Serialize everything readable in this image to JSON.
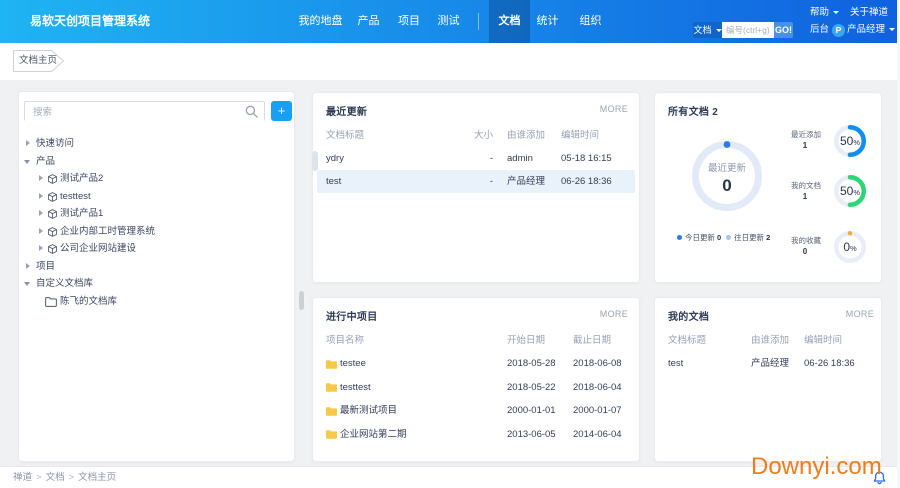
{
  "header": {
    "logo": "易软天创项目管理系统",
    "nav": [
      {
        "label": "我的地盘"
      },
      {
        "label": "产品"
      },
      {
        "label": "项目"
      },
      {
        "label": "测试"
      },
      {
        "label": "文档",
        "active": true
      },
      {
        "label": "统计"
      },
      {
        "label": "组织"
      }
    ],
    "help_label": "帮助",
    "about_label": "关于禅道",
    "search_scope": "文档",
    "search_placeholder": "编号(ctrl+g)",
    "go_label": "GO!",
    "admin_label": "后台",
    "avatar_initial": "P",
    "user_name": "产品经理"
  },
  "tabbar": {
    "active_tab": "文档主页"
  },
  "sidebar": {
    "search_placeholder": "搜索",
    "add_button": "+",
    "tree": [
      {
        "label": "快速访问"
      },
      {
        "label": "产品"
      },
      {
        "label": "测试产品2"
      },
      {
        "label": "testtest"
      },
      {
        "label": "测试产品1"
      },
      {
        "label": "企业内部工时管理系统"
      },
      {
        "label": "公司企业网站建设"
      },
      {
        "label": "项目"
      },
      {
        "label": "自定义文档库"
      },
      {
        "label": "陈飞的文档库"
      }
    ]
  },
  "cards": {
    "recent": {
      "title": "最近更新",
      "more_label": "MORE",
      "headers": [
        "文档标题",
        "大小",
        "由谁添加",
        "编辑时间"
      ],
      "rows": [
        [
          "ydry",
          "-",
          "admin",
          "05-18 16:15"
        ],
        [
          "test",
          "-",
          "产品经理",
          "06-26 18:36"
        ]
      ]
    },
    "all_docs": {
      "title": "所有文档",
      "count": "2",
      "ring_label": "最近更新",
      "ring_value": "0",
      "legend": [
        {
          "label": "今日更新",
          "value": "0",
          "color": "#2b7ce9"
        },
        {
          "label": "往日更新",
          "value": "2",
          "color": "#aac7ea"
        }
      ],
      "stats": [
        {
          "label": "最近添加",
          "value": "1",
          "percent": "50",
          "percent_sign": "%",
          "fraction": 0.5,
          "color": "#0f90ee"
        },
        {
          "label": "我的文档",
          "value": "1",
          "percent": "50",
          "percent_sign": "%",
          "fraction": 0.5,
          "color": "#2bd673"
        },
        {
          "label": "我的收藏",
          "value": "0",
          "percent": "0",
          "percent_sign": "%",
          "fraction": 0,
          "color": "#f3a93c"
        }
      ]
    },
    "projects": {
      "title": "进行中项目",
      "more_label": "MORE",
      "headers": [
        "项目名称",
        "开始日期",
        "截止日期"
      ],
      "rows": [
        [
          "testee",
          "2018-05-28",
          "2018-06-08"
        ],
        [
          "testtest",
          "2018-05-22",
          "2018-06-04"
        ],
        [
          "最新测试项目",
          "2000-01-01",
          "2000-01-07"
        ],
        [
          "企业网站第二期",
          "2013-06-05",
          "2014-06-04"
        ]
      ]
    },
    "my_docs": {
      "title": "我的文档",
      "more_label": "MORE",
      "headers": [
        "文档标题",
        "由谁添加",
        "编辑时间"
      ],
      "rows": [
        [
          "test",
          "产品经理",
          "06-26 18:36"
        ]
      ]
    }
  },
  "footer": {
    "crumbs": [
      "禅道",
      "文档",
      "文档主页"
    ]
  },
  "watermark": "Downyi.com"
}
